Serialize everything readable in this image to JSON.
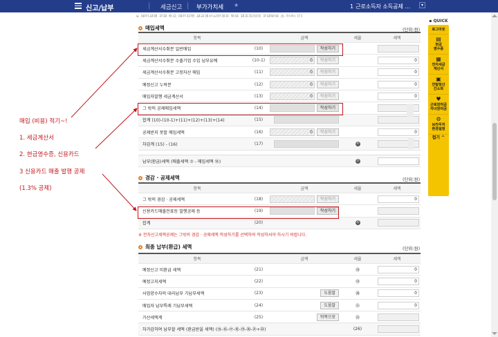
{
  "topbar": {
    "main": "신고/납부",
    "sub": "세금신고",
    "current": "부가가치세",
    "right_num": "1",
    "right_text": "근로소득자 소득공제 …"
  },
  "strip_text": "※ 매입세액 공제 등은 매입처별 세금계산서합계표 등을 제출하여야 공제받을 수 있습니다.",
  "purchase": {
    "title": "매입세액",
    "unit": "(단위:원)",
    "headers": {
      "item": "항목",
      "amount": "금액",
      "rate": "세율",
      "tax": "세액"
    },
    "rows": [
      {
        "label": "세금계산서수취분 일반매입",
        "code": "(10)",
        "amt": "",
        "btn": "작성하기",
        "rate": "",
        "tax": "",
        "style": "gray",
        "btnstyle": "dark"
      },
      {
        "label": "세금계산서수취분 수출기업 수입 납부유예",
        "code": "(10-1)",
        "amt": "0",
        "btn": "작성하기",
        "rate": "",
        "tax": "0",
        "style": "hatch",
        "btnstyle": "light"
      },
      {
        "label": "세금계산서수취분 고정자산 매입",
        "code": "(11)",
        "amt": "0",
        "btn": "작성하기",
        "rate": "",
        "tax": "0",
        "style": "hatch",
        "btnstyle": "light"
      },
      {
        "label": "예정신고 누락분",
        "code": "(12)",
        "amt": "0",
        "btn": "작성하기",
        "rate": "",
        "tax": "0",
        "style": "hatch",
        "btnstyle": "light"
      },
      {
        "label": "매입자발행 세금계산서",
        "code": "(13)",
        "amt": "0",
        "btn": "작성하기",
        "rate": "",
        "tax": "0",
        "style": "hatch",
        "btnstyle": "light"
      },
      {
        "label": "그 밖의 공제매입세액",
        "code": "(14)",
        "amt": "",
        "btn": "작성하기",
        "rate": "",
        "tax": "",
        "style": "gray",
        "btnstyle": "dark"
      },
      {
        "label": "합계 (10)-(10-1)+(11)+(12)+(13)+(14)",
        "code": "(15)",
        "amt": "",
        "btn": "",
        "rate": "",
        "tax": "",
        "style": "gray",
        "btnstyle": ""
      },
      {
        "label": "공제받지 못할 매입세액",
        "code": "(16)",
        "amt": "0",
        "btn": "작성하기",
        "rate": "",
        "tax": "0",
        "style": "hatch",
        "btnstyle": "light"
      },
      {
        "label": "차감계 (15) - (16)",
        "code": "(17)",
        "amt": "",
        "btn": "",
        "rate": "⑭",
        "tax": "",
        "style": "gray",
        "btnstyle": ""
      }
    ],
    "payable_label": "납부(환급)세액 (매출세액 ⑦ - 매입세액 ⑭)",
    "payable_rate": "⑮"
  },
  "reduction": {
    "title": "경감 · 공제세액",
    "unit": "(단위:원)",
    "headers": {
      "item": "항목",
      "amount": "금액",
      "rate": "세율",
      "tax": "세액"
    },
    "rows": [
      {
        "label": "그 밖의 경감 · 공제세액",
        "code": "(18)",
        "amt": "",
        "btn": "작성하기",
        "tax": "0",
        "style": "hatch",
        "btnstyle": "light"
      },
      {
        "label": "신용카드매출전표등 발행공제 등",
        "code": "(19)",
        "amt": "",
        "btn": "작성하기",
        "tax": "",
        "style": "gray",
        "btnstyle": "dark"
      },
      {
        "label": "합계",
        "code": "(20)",
        "amt": "",
        "btn": "",
        "tax": "",
        "style": "none",
        "btnstyle": "",
        "rate": "⑯"
      }
    ],
    "note": "※ 전자신고세액공제는 그밖의 경감 · 공제세액 작성하기를 선택하여 작성하셔야 하시기 바랍니다."
  },
  "final": {
    "title": "최종 납부(환급) 세액",
    "unit": "(단위:원)",
    "headers": {
      "item": "항목",
      "amount": "금액",
      "rate": "세율",
      "tax": "세액"
    },
    "rows": [
      {
        "label": "예정신고 미환급 세액",
        "code": "(21)",
        "btn": "",
        "rate": "⑱",
        "tax": "0"
      },
      {
        "label": "예정고지세액",
        "code": "(22)",
        "btn": "",
        "rate": "⑲",
        "tax": "0"
      },
      {
        "label": "사업양수자의 대리납부 기납부세액",
        "code": "(23)",
        "btn": "도움말",
        "rate": "⑳",
        "tax": "0"
      },
      {
        "label": "매입자 납부특례 기납부세액",
        "code": "(24)",
        "btn": "도움말",
        "rate": "㉑",
        "tax": "0"
      },
      {
        "label": "가산세액계",
        "code": "(25)",
        "btn": "뒤쪽으로",
        "rate": "㉒",
        "tax": ""
      },
      {
        "label": "차가감하여 납부할 세액 (환급받을 세액) (⑮-⑯-⑰-⑱-⑲-⑳-㉑+㉒)",
        "code": "",
        "btn": "",
        "rate": "(26)",
        "tax": ""
      }
    ]
  },
  "annotations": {
    "a1": "매입 (비용) 적기~!",
    "a2": "1. 세금계산서",
    "a3": "2. 현금영수증, 신용카드",
    "a4": "3 신용카드 매출 발행 공제",
    "a5": "(1.3% 공제)"
  },
  "quick": {
    "header": "QUICK",
    "items": [
      {
        "label": "로그아웃",
        "icon": "logout-icon",
        "glyph": ""
      },
      {
        "label": "현금\n영수증",
        "icon": "receipt-icon",
        "glyph": "▤"
      },
      {
        "label": "전자세금\n계산서",
        "icon": "invoice-icon",
        "glyph": "▦"
      },
      {
        "label": "연말정산\n간소화",
        "icon": "calc-icon",
        "glyph": "▣"
      },
      {
        "label": "근로장려금\n자녀장려금",
        "icon": "benefit-icon",
        "glyph": "♥"
      },
      {
        "label": "브라우저\n환경설정",
        "icon": "settings-icon",
        "glyph": "⚙"
      }
    ],
    "fold": "접기 ^"
  },
  "colors": {
    "nav": "#243d8b",
    "highlight": "#c0151b",
    "quick": "#f5c400",
    "section_dot": "#e67e22"
  }
}
